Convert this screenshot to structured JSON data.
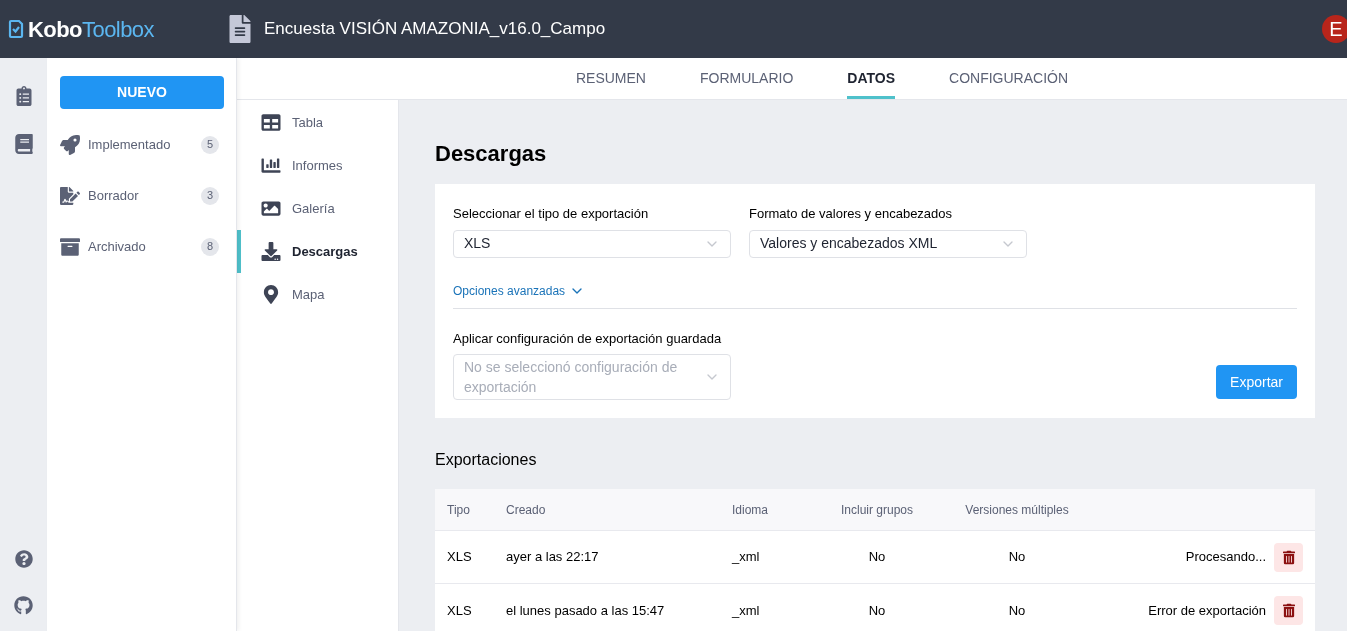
{
  "header": {
    "logo_first": "Kobo",
    "logo_second": "Toolbox",
    "title": "Encuesta VISIÓN AMAZONIA_v16.0_Campo",
    "avatar": "E"
  },
  "sidebar": {
    "new_button": "NUEVO",
    "items": [
      {
        "kind": "deployed",
        "label": "Implementado",
        "count": "5"
      },
      {
        "kind": "draft",
        "label": "Borrador",
        "count": "3"
      },
      {
        "kind": "archived",
        "label": "Archivado",
        "count": "8"
      }
    ]
  },
  "tabs": [
    {
      "label": "RESUMEN",
      "selected": false
    },
    {
      "label": "FORMULARIO",
      "selected": false
    },
    {
      "label": "DATOS",
      "selected": true
    },
    {
      "label": "CONFIGURACIÓN",
      "selected": false
    }
  ],
  "subnav": [
    {
      "kind": "table",
      "label": "Tabla",
      "selected": false
    },
    {
      "kind": "reports",
      "label": "Informes",
      "selected": false
    },
    {
      "kind": "gallery",
      "label": "Galería",
      "selected": false
    },
    {
      "kind": "downloads",
      "label": "Descargas",
      "selected": true
    },
    {
      "kind": "map",
      "label": "Mapa",
      "selected": false
    }
  ],
  "page_title": "Descargas",
  "export_form": {
    "type_label": "Seleccionar el tipo de exportación",
    "type_value": "XLS",
    "format_label": "Formato de valores y encabezados",
    "format_value": "Valores y encabezados XML",
    "advanced_link": "Opciones avanzadas",
    "saved_label": "Aplicar configuración de exportación guardada",
    "saved_placeholder": "No se seleccionó configuración de exportación",
    "export_button": "Exportar"
  },
  "exports": {
    "title": "Exportaciones",
    "columns": [
      "Tipo",
      "Creado",
      "Idioma",
      "Incluir grupos",
      "Versiones múltiples"
    ],
    "rows": [
      {
        "type": "XLS",
        "created": "ayer a las 22:17",
        "language": "_xml",
        "groups": "No",
        "versions": "No",
        "status": "Procesando..."
      },
      {
        "type": "XLS",
        "created": "el lunes pasado a las 15:47",
        "language": "_xml",
        "groups": "No",
        "versions": "No",
        "status": "Error de exportación"
      }
    ]
  }
}
